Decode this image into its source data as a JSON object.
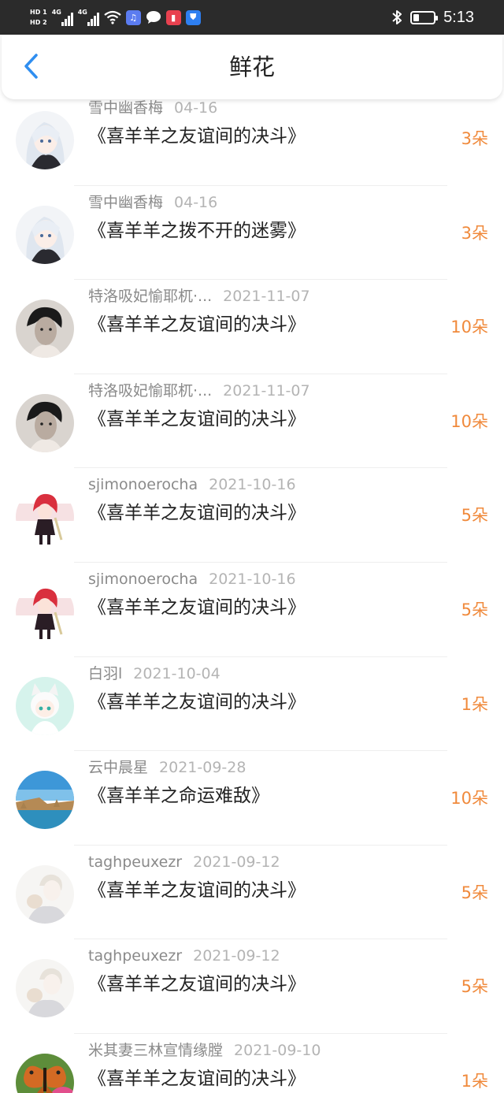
{
  "status_bar": {
    "sim1": "HD 1",
    "sim2": "HD 2",
    "net1": "4G",
    "net2": "4G",
    "time": "5:13",
    "battery_level": 0.3,
    "icons": [
      "wifi-icon",
      "itunes-app-icon",
      "message-app-icon",
      "book-app-icon",
      "shield-app-icon",
      "bluetooth-icon",
      "battery-icon"
    ]
  },
  "header": {
    "title": "鲜花",
    "back_icon": "chevron-left-icon",
    "accent": "#2f8ef0"
  },
  "colors": {
    "count": "#f08a3c",
    "name": "#8a8a8a",
    "date": "#b4b4b4"
  },
  "items": [
    {
      "user": "雪中幽香梅",
      "date": "04-16",
      "work": "《喜羊羊之友谊间的决斗》",
      "count": "3朵",
      "avatar": "anime-girl-white-hair"
    },
    {
      "user": "雪中幽香梅",
      "date": "04-16",
      "work": "《喜羊羊之拨不开的迷雾》",
      "count": "3朵",
      "avatar": "anime-girl-white-hair"
    },
    {
      "user": "特洛吸妃愉耶杌·...",
      "date": "2021-11-07",
      "work": "《喜羊羊之友谊间的决斗》",
      "count": "10朵",
      "avatar": "bw-portrait"
    },
    {
      "user": "特洛吸妃愉耶杌·...",
      "date": "2021-11-07",
      "work": "《喜羊羊之友谊间的决斗》",
      "count": "10朵",
      "avatar": "bw-portrait"
    },
    {
      "user": "sjimonoerocha",
      "date": "2021-10-16",
      "work": "《喜羊羊之友谊间的决斗》",
      "count": "5朵",
      "avatar": "anime-red-hair"
    },
    {
      "user": "sjimonoerocha",
      "date": "2021-10-16",
      "work": "《喜羊羊之友谊间的决斗》",
      "count": "5朵",
      "avatar": "anime-red-hair"
    },
    {
      "user": "白羽l",
      "date": "2021-10-04",
      "work": "《喜羊羊之友谊间的决斗》",
      "count": "1朵",
      "avatar": "anime-cat-boy"
    },
    {
      "user": "云中晨星",
      "date": "2021-09-28",
      "work": "《喜羊羊之命运难敌》",
      "count": "10朵",
      "avatar": "coast-landscape"
    },
    {
      "user": "taghpeuxezr",
      "date": "2021-09-12",
      "work": "《喜羊羊之友谊间的决斗》",
      "count": "5朵",
      "avatar": "anime-boy-sketch"
    },
    {
      "user": "taghpeuxezr",
      "date": "2021-09-12",
      "work": "《喜羊羊之友谊间的决斗》",
      "count": "5朵",
      "avatar": "anime-boy-sketch"
    },
    {
      "user": "米其妻三林宣情缘膛",
      "date": "2021-09-10",
      "work": "《喜羊羊之友谊间的决斗》",
      "count": "1朵",
      "avatar": "butterfly-photo"
    }
  ]
}
